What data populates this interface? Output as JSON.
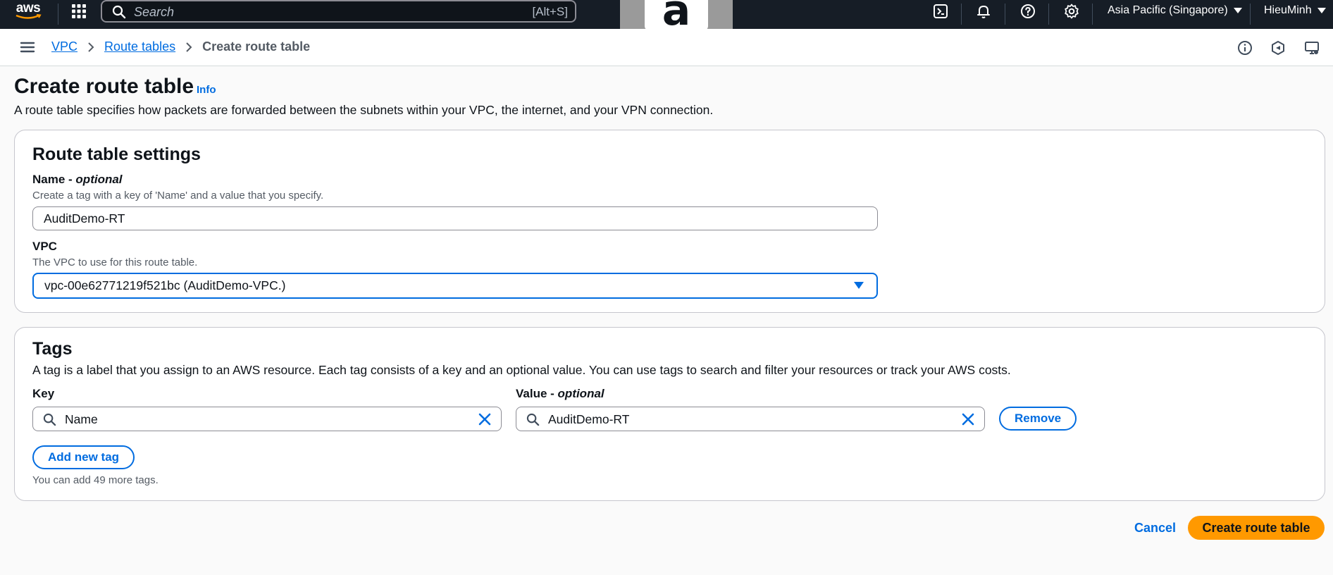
{
  "topbar": {
    "logo_text": "aws",
    "search_placeholder": "Search",
    "search_shortcut": "[Alt+S]",
    "region": "Asia Pacific (Singapore)",
    "user": "HieuMinh"
  },
  "overlay": {
    "letter": "a"
  },
  "breadcrumb": {
    "items": [
      "VPC",
      "Route tables"
    ],
    "current": "Create route table"
  },
  "page": {
    "title": "Create route table",
    "info_label": "Info",
    "description": "A route table specifies how packets are forwarded between the subnets within your VPC, the internet, and your VPN connection."
  },
  "settings": {
    "title": "Route table settings",
    "name_label": "Name",
    "name_optional": "optional",
    "name_hint": "Create a tag with a key of 'Name' and a value that you specify.",
    "name_value": "AuditDemo-RT",
    "vpc_label": "VPC",
    "vpc_hint": "The VPC to use for this route table.",
    "vpc_value": "vpc-00e62771219f521bc (AuditDemo-VPC.)"
  },
  "tags": {
    "title": "Tags",
    "description": "A tag is a label that you assign to an AWS resource. Each tag consists of a key and an optional value. You can use tags to search and filter your resources or track your AWS costs.",
    "key_label": "Key",
    "value_label": "Value",
    "value_optional": "optional",
    "rows": [
      {
        "key": "Name",
        "value": "AuditDemo-RT"
      }
    ],
    "remove_label": "Remove",
    "add_label": "Add new tag",
    "remaining_hint": "You can add 49 more tags."
  },
  "actions": {
    "cancel_label": "Cancel",
    "create_label": "Create route table"
  },
  "colors": {
    "topbar_bg": "#161d26",
    "link_blue": "#006ce0",
    "primary_orange": "#ff9900"
  }
}
